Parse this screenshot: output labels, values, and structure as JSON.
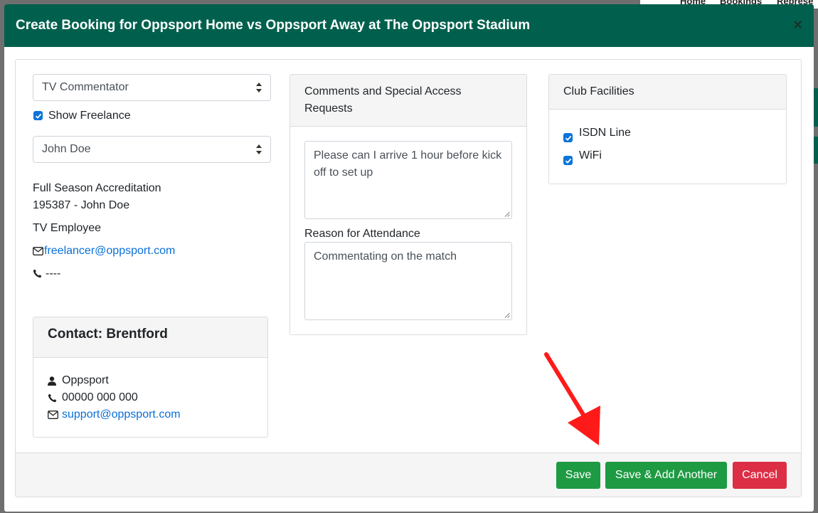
{
  "background": {
    "nav": [
      "Home",
      "Bookings",
      "Represe"
    ]
  },
  "modal": {
    "title": "Create Booking for Oppsport Home vs Oppsport Away at The Oppsport Stadium",
    "close_label": "×"
  },
  "left": {
    "role_select": "TV Commentator",
    "show_freelance_label": "Show Freelance",
    "show_freelance_checked": true,
    "person_select": "John Doe",
    "accreditation": "Full Season Accreditation",
    "accreditation_id": "195387 - John Doe",
    "employee_type": "TV Employee",
    "email": "freelancer@oppsport.com",
    "phone": "----"
  },
  "contact": {
    "title": "Contact: Brentford",
    "name": "Oppsport",
    "phone": "00000 000 000",
    "email": "support@oppsport.com"
  },
  "comments": {
    "title": "Comments and Special Access Requests",
    "comment_value": "Please can I arrive 1 hour before kick off to set up",
    "reason_label": "Reason for Attendance",
    "reason_value": "Commentating on the match"
  },
  "facilities": {
    "title": "Club Facilities",
    "items": [
      {
        "label": "ISDN Line",
        "checked": true
      },
      {
        "label": "WiFi",
        "checked": true
      }
    ]
  },
  "footer": {
    "save_label": "Save",
    "save_add_label": "Save & Add Another",
    "cancel_label": "Cancel"
  },
  "colors": {
    "header": "#00604d",
    "primary_green": "#1e9a43",
    "danger": "#dc2f45",
    "link": "#0a6fd8",
    "annotation_arrow": "#ff1a1a"
  }
}
